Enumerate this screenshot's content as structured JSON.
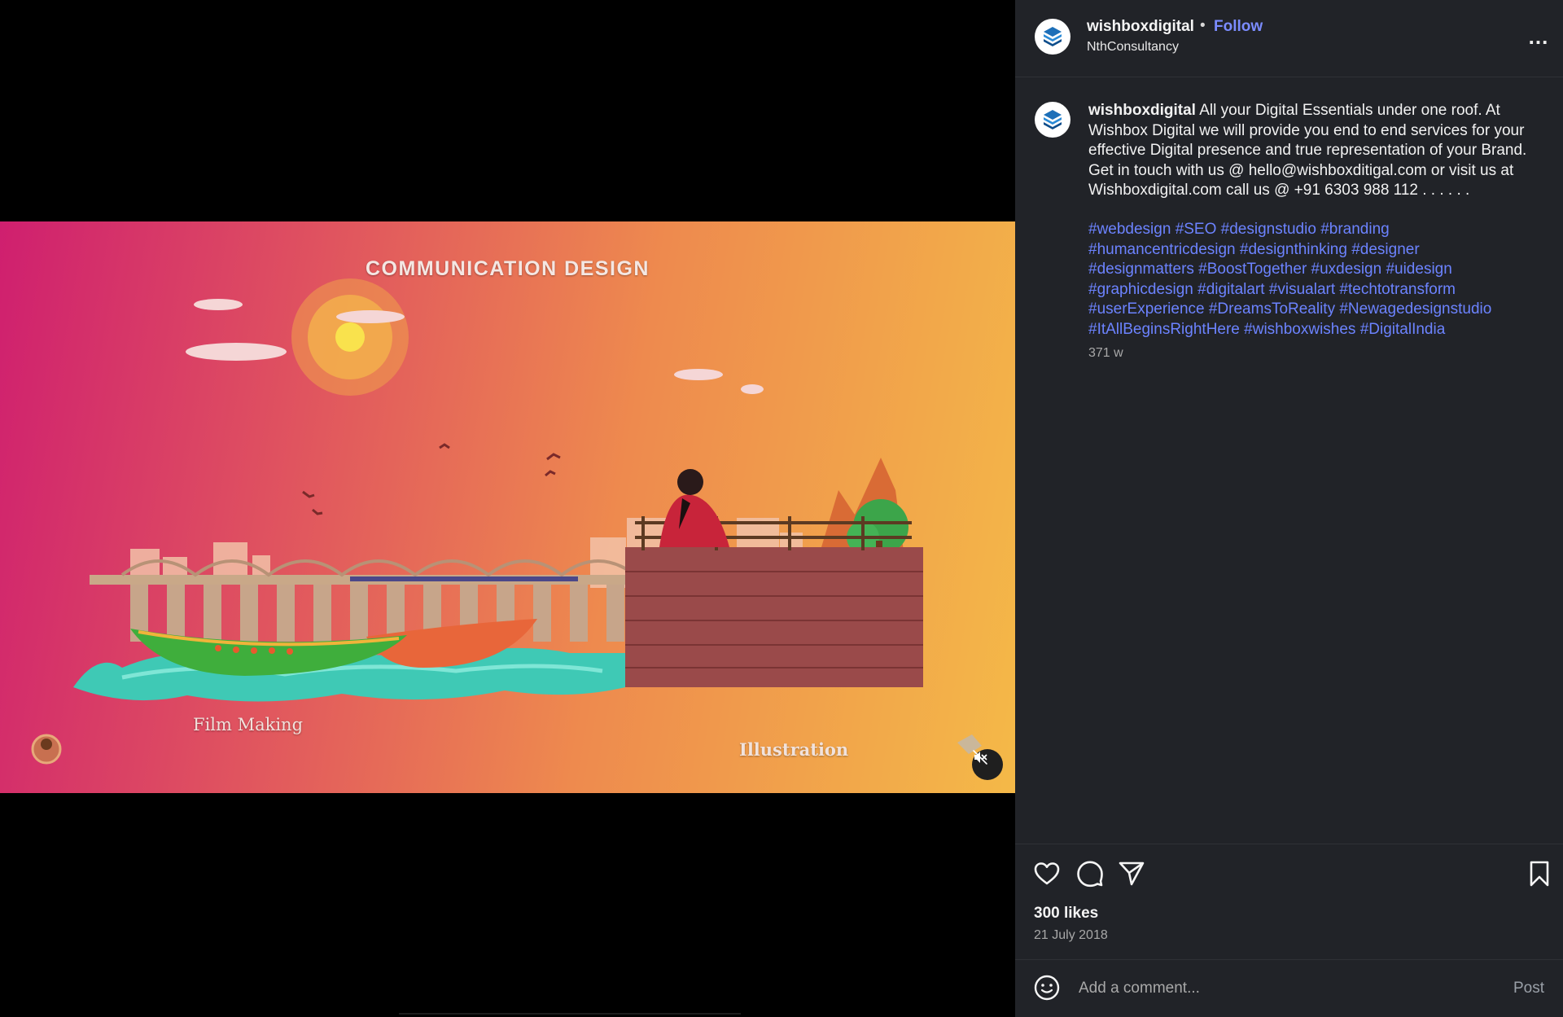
{
  "video": {
    "title": "COMMUNICATION DESIGN",
    "caption_left": "Film Making",
    "caption_right": "Illustration",
    "muted": true
  },
  "header": {
    "username": "wishboxdigital",
    "separator": "•",
    "follow_label": "Follow",
    "subtitle": "NthConsultancy",
    "more_label": "..."
  },
  "caption": {
    "username": "wishboxdigital",
    "text": "All your Digital Essentials under one roof. At Wishbox Digital we will provide you end to end services for your effective Digital presence and true representation of your Brand. Get in touch with us @ hello@wishboxditigal.com or visit us at Wishboxdigital.com  call us @ +91 6303 988 112 . . . . . .",
    "hashtag_lines": [
      "#webdesign #SEO #designstudio #branding",
      "#humancentricdesign #designthinking #designer",
      "#designmatters #BoostTogether #uxdesign #uidesign",
      "#graphicdesign #digitalart #visualart #techtotransform",
      "#userExperience #DreamsToReality #Newagedesignstudio",
      "#ItAllBeginsRightHere #wishboxwishes #DigitalIndia"
    ],
    "time_ago": "371 w"
  },
  "actions": {
    "likes": "300 likes",
    "date": "21 July 2018"
  },
  "comment": {
    "placeholder": "Add a comment...",
    "post_label": "Post"
  },
  "colors": {
    "panel_bg": "#212328",
    "link_blue": "#7b8cff",
    "hashtag_blue": "#6c83ff",
    "muted_text": "#a8a8a8"
  }
}
